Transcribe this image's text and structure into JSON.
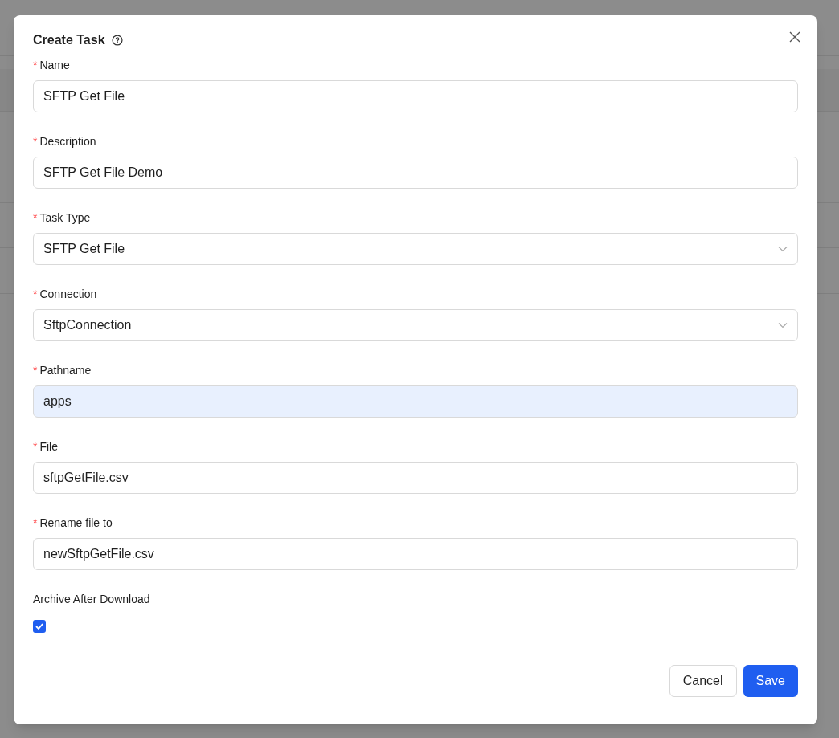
{
  "dialog": {
    "title": "Create Task",
    "fields": [
      {
        "kind": "text",
        "required_mark": "*",
        "label": "Name",
        "value": "SFTP Get File",
        "autofilled": false
      },
      {
        "kind": "text",
        "required_mark": "*",
        "label": "Description",
        "value": "SFTP Get File Demo",
        "autofilled": false
      },
      {
        "kind": "select",
        "required_mark": "*",
        "label": "Task Type",
        "value": "SFTP Get File"
      },
      {
        "kind": "select",
        "required_mark": "*",
        "label": "Connection",
        "value": "SftpConnection"
      },
      {
        "kind": "text",
        "required_mark": "*",
        "label": "Pathname",
        "value": "apps",
        "autofilled": true
      },
      {
        "kind": "text",
        "required_mark": "*",
        "label": "File",
        "value": "sftpGetFile.csv",
        "autofilled": false
      },
      {
        "kind": "text",
        "required_mark": "*",
        "label": "Rename file to",
        "value": "newSftpGetFile.csv",
        "autofilled": false
      },
      {
        "kind": "checkbox",
        "label": "Archive After Download",
        "checked": true
      }
    ],
    "buttons": [
      {
        "kind": "secondary",
        "label": "Cancel"
      },
      {
        "kind": "primary",
        "label": "Save"
      }
    ]
  }
}
